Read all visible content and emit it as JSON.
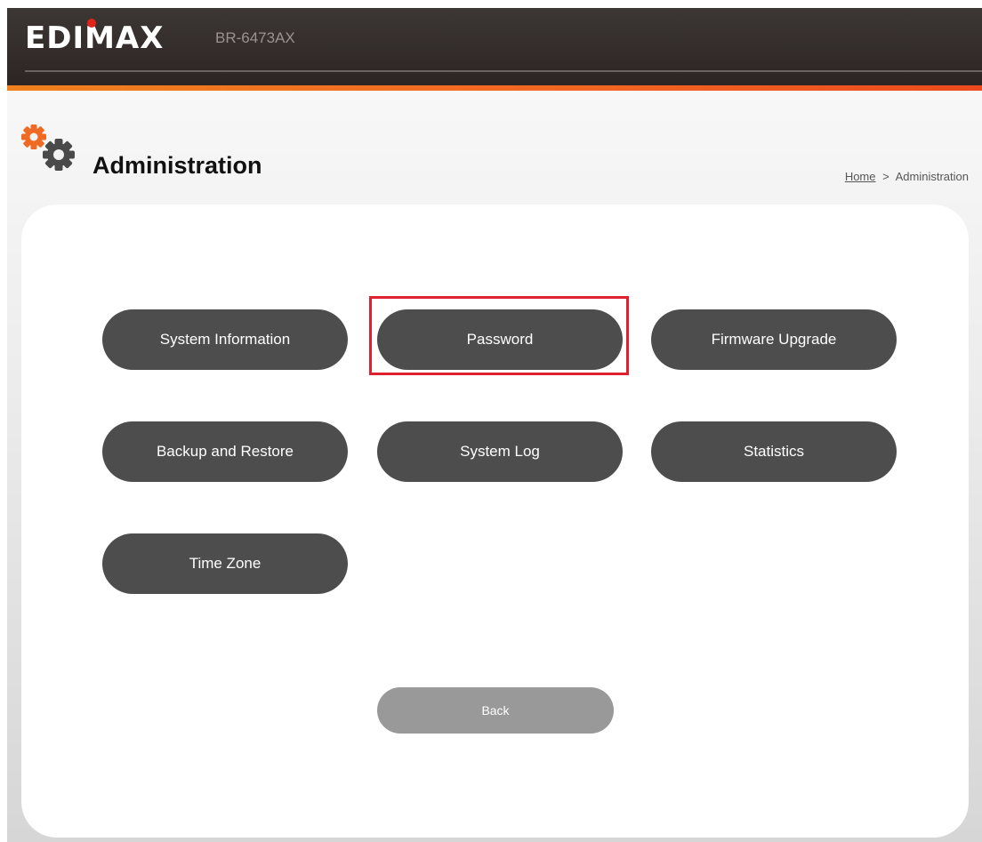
{
  "header": {
    "logo_text": "EDIMAX",
    "model": "BR-6473AX",
    "colors": {
      "bar": "#2f2826",
      "accent": "#f26522",
      "logo_dot": "#e2231a"
    }
  },
  "page": {
    "icon": "gears-icon",
    "title": "Administration"
  },
  "breadcrumb": {
    "home_label": "Home",
    "separator": ">",
    "current": "Administration"
  },
  "menu": {
    "system_information": "System Information",
    "password": "Password",
    "firmware_upgrade": "Firmware Upgrade",
    "backup_and_restore": "Backup and Restore",
    "system_log": "System Log",
    "statistics": "Statistics",
    "time_zone": "Time Zone"
  },
  "back_label": "Back",
  "highlighted_item": "password",
  "colors": {
    "button": "#4d4d4d",
    "back_button": "#999999",
    "highlight": "#e0202e"
  }
}
